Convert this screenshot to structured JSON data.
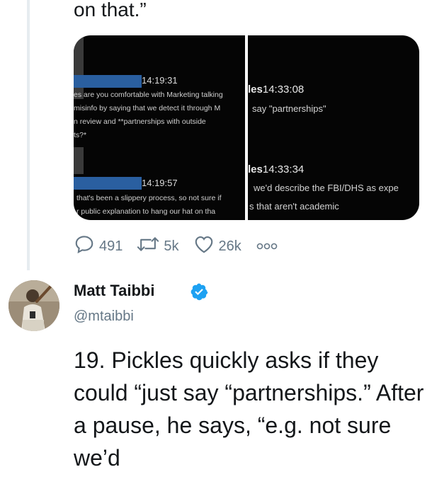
{
  "previous_tweet": {
    "text_tail": "on that.”",
    "media": {
      "left": {
        "timestamp_1": "14:19:31",
        "message_1": [
          "es are you comfortable with Marketing talking",
          " misinfo by saying that we detect it through M",
          "n review and **partnerships with outside",
          "ts?*"
        ],
        "timestamp_2": "14:19:57",
        "message_2": [
          "that's been a slippery process, so not sure if",
          "r public explanation to hang our hat on tha"
        ]
      },
      "right": {
        "name_1": "les",
        "time_1": "14:33:08",
        "message_1": "say \"partnerships\"",
        "name_2": "les",
        "time_2": "14:33:34",
        "message_2": [
          "we'd describe the FBI/DHS as expe",
          "s that aren't academic"
        ]
      }
    },
    "actions": {
      "replies": "491",
      "retweets": "5k",
      "likes": "26k"
    }
  },
  "tweet": {
    "display_name": "Matt Taibbi",
    "handle": "@mtaibbi",
    "text": "19.  Pickles quickly asks if they could “just say “partnerships.” After a pause, he says, “e.g. not sure we’d"
  },
  "colors": {
    "verified": "#1da1f2",
    "redaction": "#2a5fa0",
    "secondary_text": "#657786"
  },
  "icons": [
    "reply-icon",
    "retweet-icon",
    "like-icon",
    "more-icon",
    "verified-badge-icon"
  ]
}
